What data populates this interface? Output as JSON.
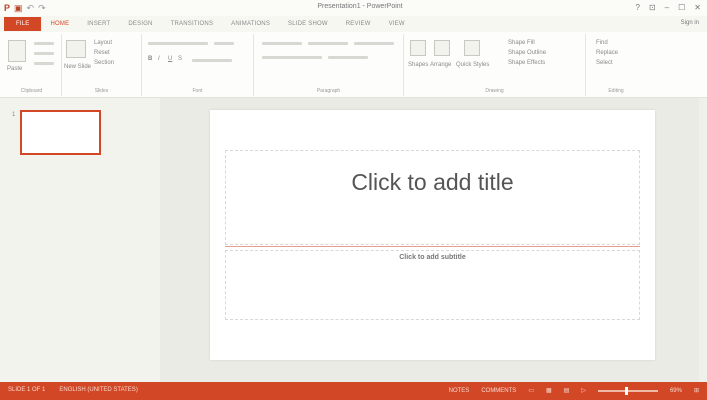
{
  "window": {
    "title": "Presentation1 - PowerPoint",
    "controls": [
      "?",
      "⊡",
      "–",
      "☐",
      "✕"
    ]
  },
  "qat": {
    "app_icon": "P",
    "save_icon": "save-icon",
    "undo_icon": "undo-icon",
    "redo_icon": "redo-icon"
  },
  "tabs": [
    {
      "label": "FILE",
      "state": "file"
    },
    {
      "label": "HOME",
      "state": "active"
    },
    {
      "label": "INSERT",
      "state": ""
    },
    {
      "label": "DESIGN",
      "state": ""
    },
    {
      "label": "TRANSITIONS",
      "state": ""
    },
    {
      "label": "ANIMATIONS",
      "state": ""
    },
    {
      "label": "SLIDE SHOW",
      "state": ""
    },
    {
      "label": "REVIEW",
      "state": ""
    },
    {
      "label": "VIEW",
      "state": ""
    }
  ],
  "signin": "Sign in",
  "ribbon": {
    "clipboard_label": "Clipboard",
    "paste_label": "Paste",
    "slides_label": "Slides",
    "new_slide_label": "New Slide",
    "layout_label": "Layout",
    "reset_label": "Reset",
    "section_label": "Section",
    "font_label": "Font",
    "paragraph_label": "Paragraph",
    "drawing_label": "Drawing",
    "shapes_label": "Shapes",
    "arrange_label": "Arrange",
    "quick_styles_label": "Quick Styles",
    "shape_fill_label": "Shape Fill",
    "shape_outline_label": "Shape Outline",
    "shape_effects_label": "Shape Effects",
    "editing_label": "Editing",
    "find_label": "Find",
    "replace_label": "Replace",
    "select_label": "Select"
  },
  "thumbnails": [
    {
      "number": "1"
    }
  ],
  "slide": {
    "title_placeholder": "Click to add title",
    "subtitle_placeholder": "Click to add subtitle"
  },
  "status": {
    "slide_info": "SLIDE 1 OF 1",
    "language": "ENGLISH (UNITED STATES)",
    "notes": "NOTES",
    "comments": "COMMENTS",
    "zoom": "69%",
    "zoom_fraction": 0.47
  },
  "colors": {
    "accent": "#d24726"
  }
}
